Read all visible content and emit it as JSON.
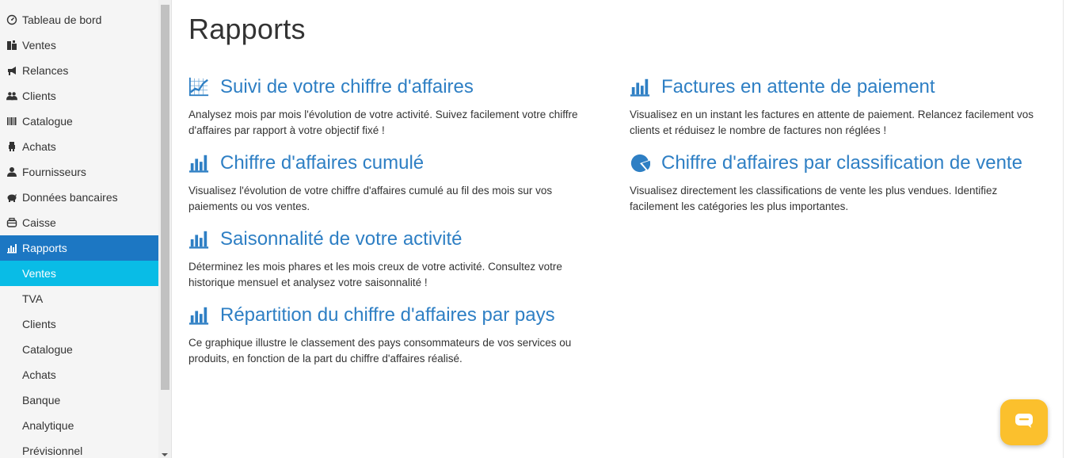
{
  "sidebar": {
    "items": [
      {
        "label": "Tableau de bord",
        "icon": "dashboard-icon"
      },
      {
        "label": "Ventes",
        "icon": "sales-icon"
      },
      {
        "label": "Relances",
        "icon": "megaphone-icon"
      },
      {
        "label": "Clients",
        "icon": "users-icon"
      },
      {
        "label": "Catalogue",
        "icon": "barcode-icon"
      },
      {
        "label": "Achats",
        "icon": "purchases-icon"
      },
      {
        "label": "Fournisseurs",
        "icon": "user-icon"
      },
      {
        "label": "Données bancaires",
        "icon": "piggy-bank-icon"
      },
      {
        "label": "Caisse",
        "icon": "cash-icon"
      },
      {
        "label": "Rapports",
        "icon": "bar-chart-icon"
      }
    ],
    "subitems": [
      {
        "label": "Ventes"
      },
      {
        "label": "TVA"
      },
      {
        "label": "Clients"
      },
      {
        "label": "Catalogue"
      },
      {
        "label": "Achats"
      },
      {
        "label": "Banque"
      },
      {
        "label": "Analytique"
      },
      {
        "label": "Prévisionnel"
      }
    ]
  },
  "page": {
    "title": "Rapports"
  },
  "reports": [
    {
      "title": "Suivi de votre chiffre d'affaires",
      "desc_l1": "Analysez mois par mois l'évolution de votre activité. Suivez facilement votre chiffre",
      "desc_l2": "d'affaires par rapport à votre objectif fixé !",
      "icon": "line-chart-icon"
    },
    {
      "title": "Chiffre d'affaires cumulé",
      "desc_l1": "Visualisez l'évolution de votre chiffre d'affaires cumulé au fil des mois sur vos",
      "desc_l2": "paiements ou vos ventes.",
      "icon": "bar-chart-icon"
    },
    {
      "title": "Saisonnalité de votre activité",
      "desc_l1": "Déterminez les mois phares et les mois creux de votre activité. Consultez votre",
      "desc_l2": "historique mensuel et analysez votre saisonnalité !",
      "icon": "bar-chart-icon"
    },
    {
      "title": "Répartition du chiffre d'affaires par pays",
      "desc_l1": "Ce graphique illustre le classement des pays consommateurs de vos services ou",
      "desc_l2": "produits, en fonction de la part du chiffre d'affaires réalisé.",
      "icon": "bar-chart-icon"
    },
    {
      "title": "Factures en attente de paiement",
      "desc_l1": "Visualisez en un instant les factures en attente de paiement. Relancez facilement vos",
      "desc_l2": "clients et réduisez le nombre de factures non réglées !",
      "icon": "bar-chart-icon"
    },
    {
      "title": "Chiffre d'affaires par classification de vente",
      "desc_l1": "Visualisez directement les classifications de vente les plus vendues. Identifiez",
      "desc_l2": "facilement les catégories les plus importantes.",
      "icon": "pie-chart-icon"
    }
  ],
  "colors": {
    "accent": "#1c77c3",
    "sub_active": "#09bce6",
    "link": "#2e7fc4",
    "chat": "#fbc02d"
  },
  "chat": {
    "icon": "chat-icon"
  }
}
